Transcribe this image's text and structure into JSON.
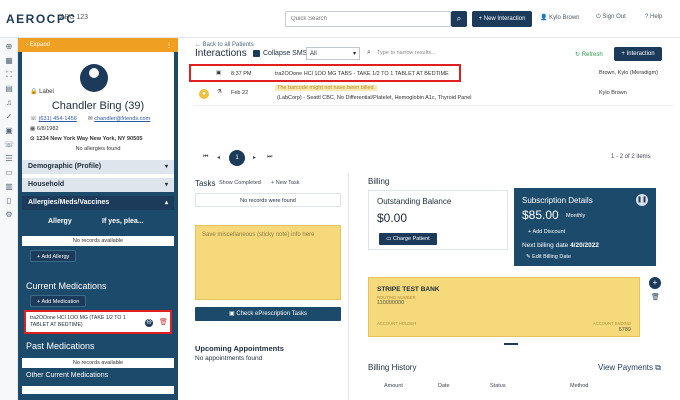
{
  "header": {
    "logo": "AEROCPC",
    "subtitle": "ABC 123",
    "search_placeholder": "Quick Search",
    "new_interaction": "New Interaction",
    "user": "Kylo Brown",
    "sign_out": "Sign Out",
    "help": "Help"
  },
  "patient": {
    "expand": "Expand",
    "label": "Label",
    "name": "Chandler Bing (39)",
    "phone": "(631) 454-1456",
    "email": "chandler@friends.com",
    "dob": "6/8/1982",
    "address": "1234 New York Way New York, NY 90505",
    "allergies_note": "No allergies found"
  },
  "left_sections": {
    "demographic": "Demographic (Profile)",
    "household": "Household",
    "allergies": "Allergies/Meds/Vaccines",
    "allergy_col": "Allergy",
    "ifyes_col": "If yes, plea...",
    "no_records": "No records available",
    "add_allergy": "Add Allergy",
    "current_meds": "Current Medications",
    "add_med": "Add Medication",
    "med_text": "tra2OOone HCl 1OO MG (TAKE 1/2 TO 1 TABLET AT BEDTIME)",
    "past_meds": "Past Medications",
    "no_records_2": "No records available",
    "other_meds": "Other Current Medications"
  },
  "interactions": {
    "back": "Back to all Patients",
    "title": "Interactions",
    "collapse": "Collapse SMS",
    "filter": "All",
    "search_placeholder": "Type to narrow results...",
    "refresh": "Refresh",
    "add": "Interaction",
    "rows": [
      {
        "time": "8:37 PM",
        "text": "tra2OOone HCl 1OO MG TABS - TAKE 1/2 TO 1 TABLET AT BEDTIME",
        "who": "Brown, Kylo (Meradigm)"
      },
      {
        "time": "Feb 22",
        "text": "The barcode might not have been billed.",
        "text2": "(LabCorp) - Seattl CBC, No Differential/Platelet, Hemoglobin A1c, Thyroid Panel",
        "who": "Kylo Brown"
      }
    ],
    "page": "1",
    "count": "1 - 2 of 2 items"
  },
  "tasks": {
    "title": "Tasks",
    "show_completed": "Show Completed",
    "new_task": "New Task",
    "no_records": "No records were found",
    "sticky_placeholder": "Save miscellaneous (sticky note) info here",
    "eprescribe": "Check ePrescription Tasks",
    "appointments_title": "Upcoming Appointments",
    "no_appointments": "No appointments found"
  },
  "billing": {
    "title": "Billing",
    "outstanding_title": "Outstanding Balance",
    "outstanding_amount": "$0.00",
    "charge_patient": "Charge Patient",
    "subscription_title": "Subscription Details",
    "subscription_amount": "$85.00",
    "subscription_period": "Monthly",
    "add_discount": "Add Discount",
    "next_billing": "Next billing date",
    "next_billing_date": "4/20/2022",
    "edit_billing": "Edit Billing Date",
    "bank_title": "STRIPE TEST BANK",
    "routing_label": "ROUTING NUMBER",
    "routing_number": "110000000",
    "holder_label": "ACCOUNT HOLDER",
    "account_label": "ACCOUNT ENDING",
    "account_ending": "6789",
    "history_title": "Billing History",
    "view_payments": "View Payments",
    "history_cols": [
      "Amount",
      "Date",
      "Status",
      "Method"
    ]
  },
  "colors": {
    "navy": "#1c3b5a",
    "panel": "#1c4a6a",
    "highlight": "#e02020",
    "sticky": "#f6d97a",
    "orange": "#f0a020"
  }
}
